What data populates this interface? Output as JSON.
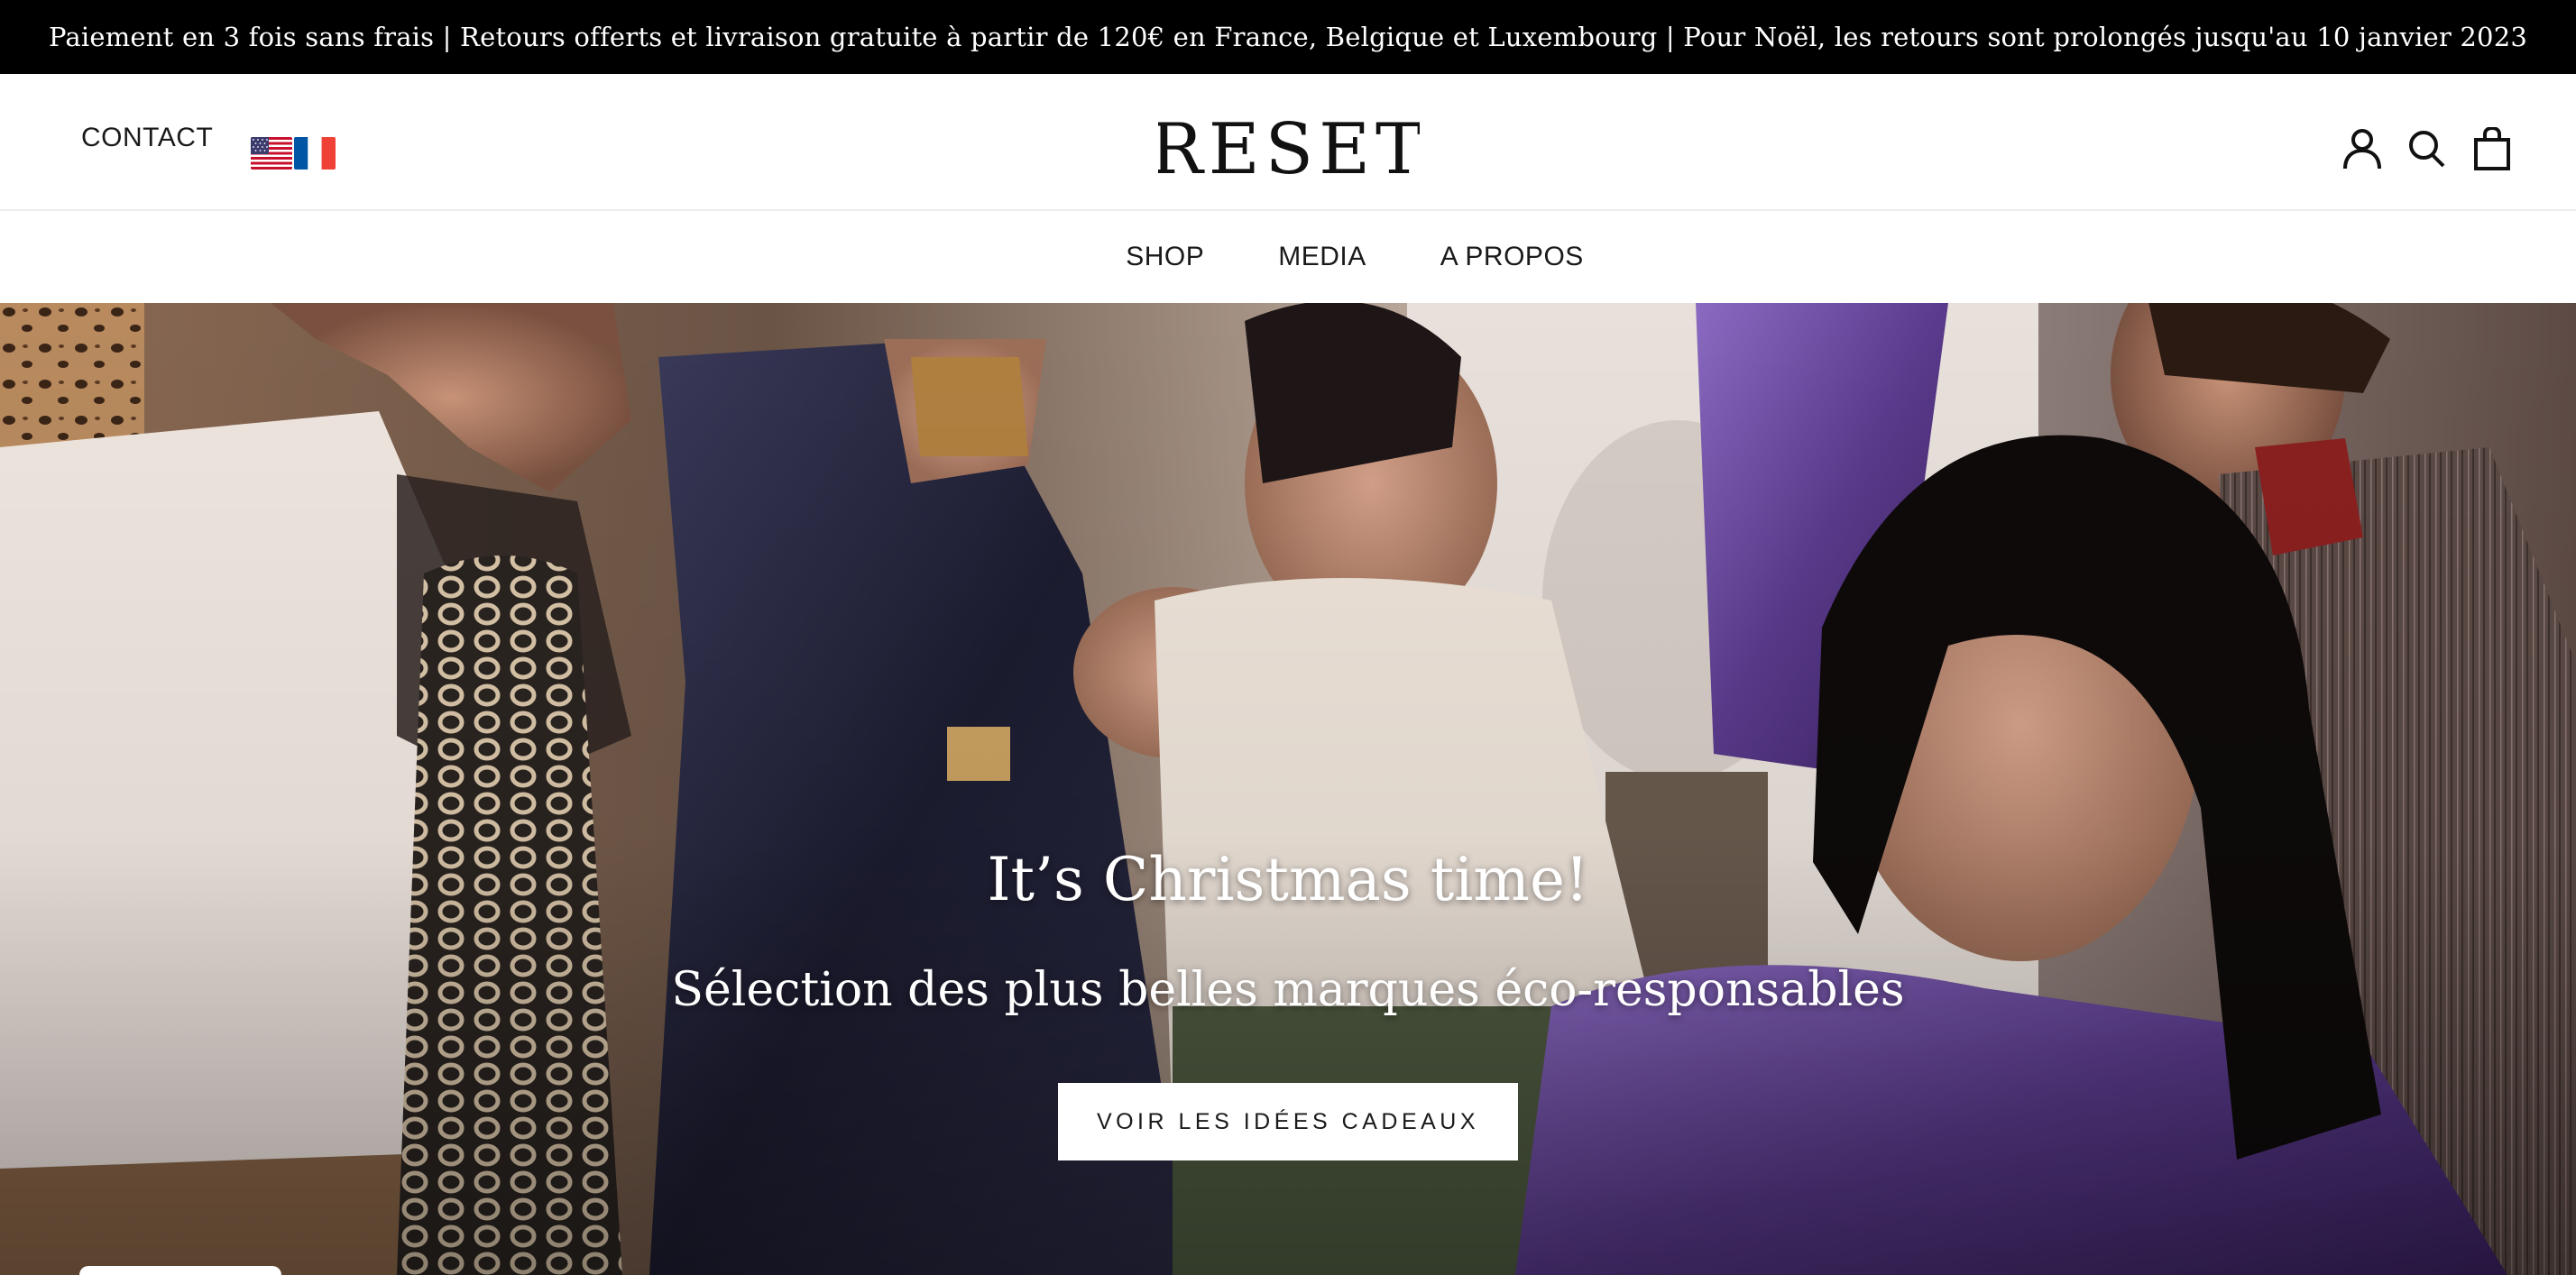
{
  "announcement": {
    "text": "Paiement en 3 fois sans frais | Retours offerts et livraison gratuite à partir de 120€ en France, Belgique et Luxembourg | Pour Noël, les retours sont prolongés jusqu'au 10 janvier 2023"
  },
  "header": {
    "contact_label": "CONTACT",
    "languages": [
      {
        "icon": "us-flag-icon"
      },
      {
        "icon": "fr-flag-icon"
      }
    ],
    "logo_text": "RESET",
    "icons": [
      "account-icon",
      "search-icon",
      "cart-icon"
    ]
  },
  "nav": {
    "items": [
      {
        "label": "SHOP"
      },
      {
        "label": "MEDIA"
      },
      {
        "label": "A PROPOS"
      }
    ]
  },
  "hero": {
    "title": "It’s Christmas time!",
    "subtitle": "Sélection des plus belles marques éco-responsables",
    "cta_label": "VOIR LES IDÉES CADEAUX"
  },
  "colors": {
    "announcement_bg": "#000000",
    "announcement_text": "#ffffff",
    "header_bg": "#ffffff",
    "text": "#1a1a1a",
    "hero_overlay_text": "#ffffff"
  }
}
